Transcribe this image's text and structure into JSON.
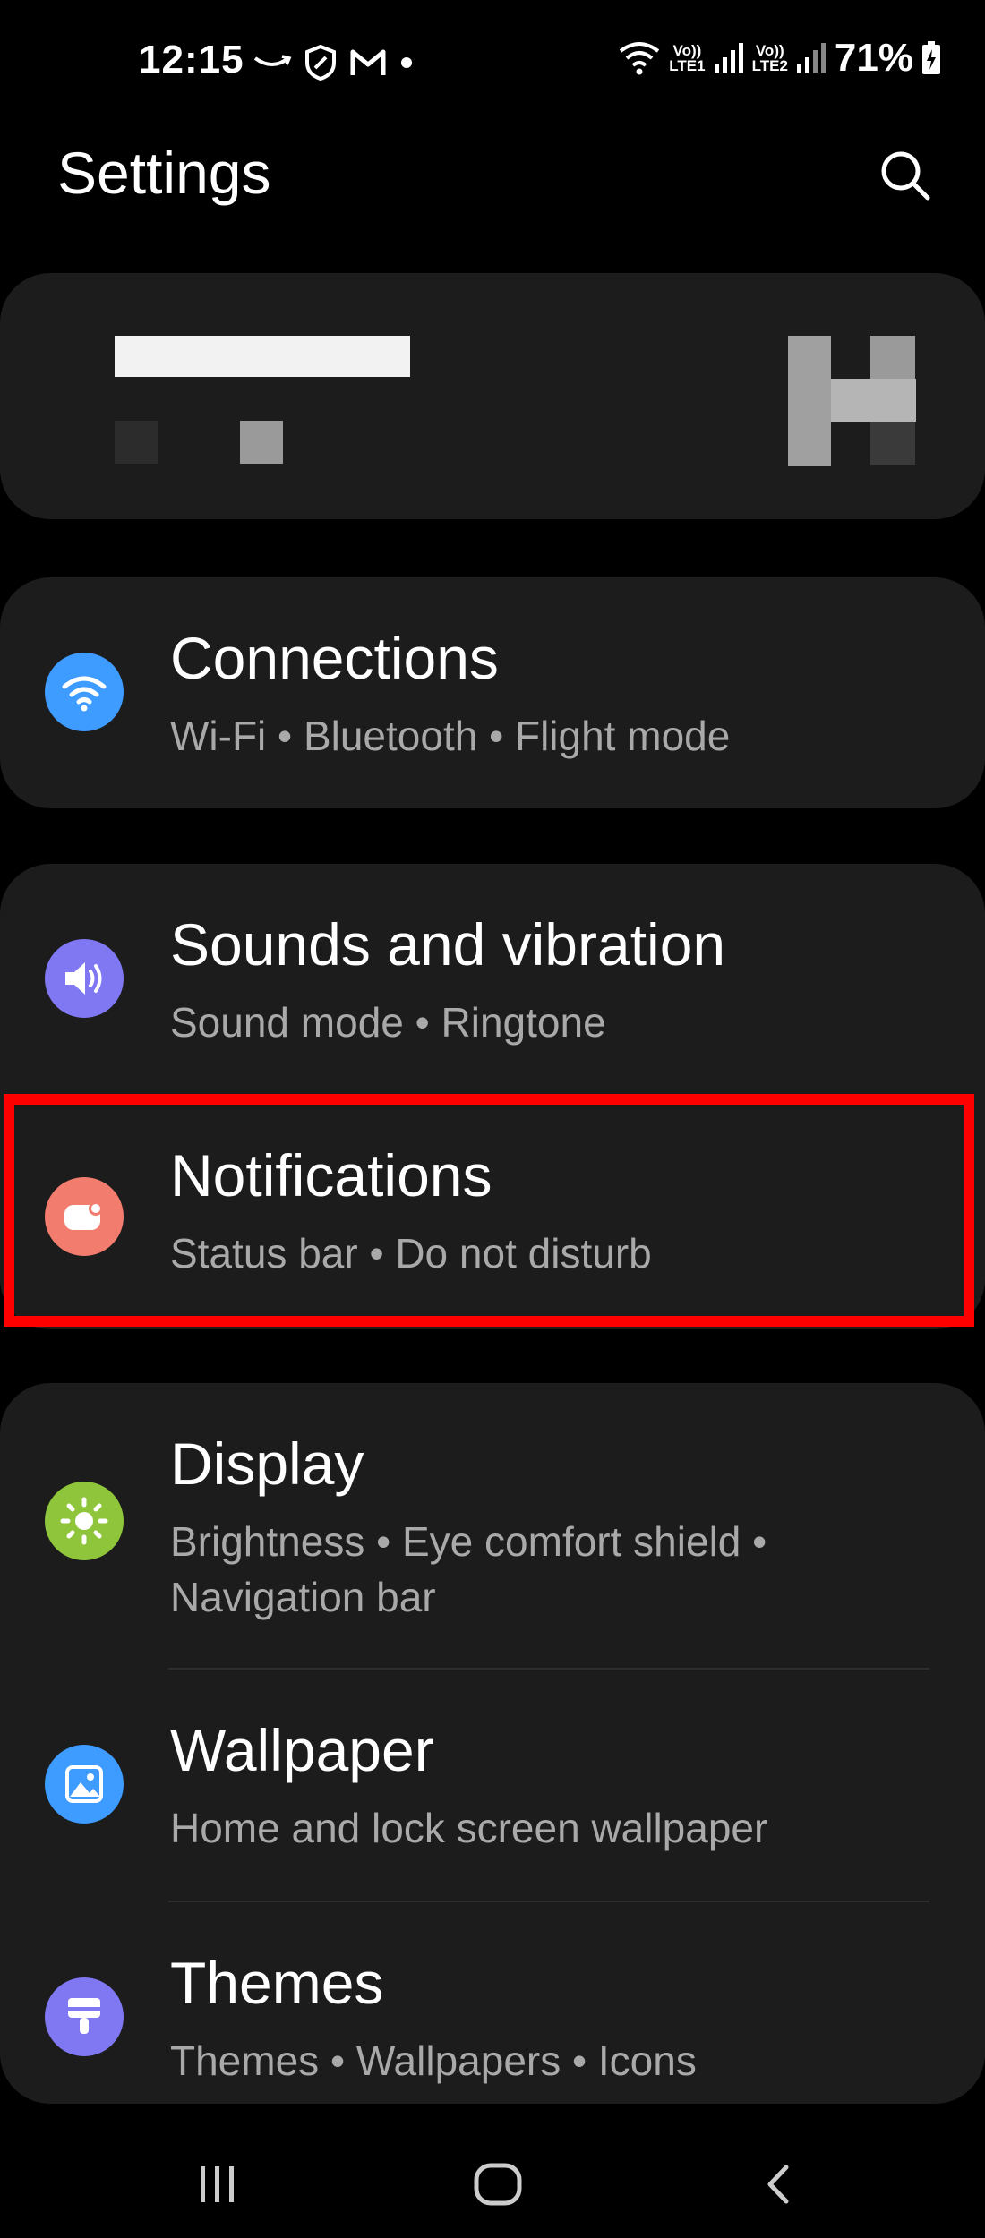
{
  "status_bar": {
    "time": "12:15",
    "battery": "71%",
    "sim1": {
      "top": "Vo))",
      "bottom": "LTE1"
    },
    "sim2": {
      "top": "Vo))",
      "bottom": "LTE2"
    }
  },
  "header": {
    "title": "Settings"
  },
  "items": [
    {
      "title": "Connections",
      "subtitle": "Wi-Fi  •  Bluetooth  •  Flight mode",
      "icon": "wifi-icon",
      "color": "#3e9bff"
    },
    {
      "title": "Sounds and vibration",
      "subtitle": "Sound mode  •  Ringtone",
      "icon": "speaker-icon",
      "color": "#7f78f2"
    },
    {
      "title": "Notifications",
      "subtitle": "Status bar  •  Do not disturb",
      "icon": "notification-icon",
      "color": "#f27c6e"
    },
    {
      "title": "Display",
      "subtitle1": "Brightness  •  Eye comfort shield  •",
      "subtitle2": "Navigation bar",
      "icon": "sun-icon",
      "color": "#8ec53a"
    },
    {
      "title": "Wallpaper",
      "subtitle": "Home and lock screen wallpaper",
      "icon": "image-icon",
      "color": "#3e9bff"
    },
    {
      "title": "Themes",
      "subtitle": "Themes  •  Wallpapers  •  Icons",
      "icon": "brush-icon",
      "color": "#7f78f2"
    }
  ],
  "colors": {
    "highlight": "#ff0000",
    "background": "#000000",
    "card": "#1c1c1c"
  }
}
